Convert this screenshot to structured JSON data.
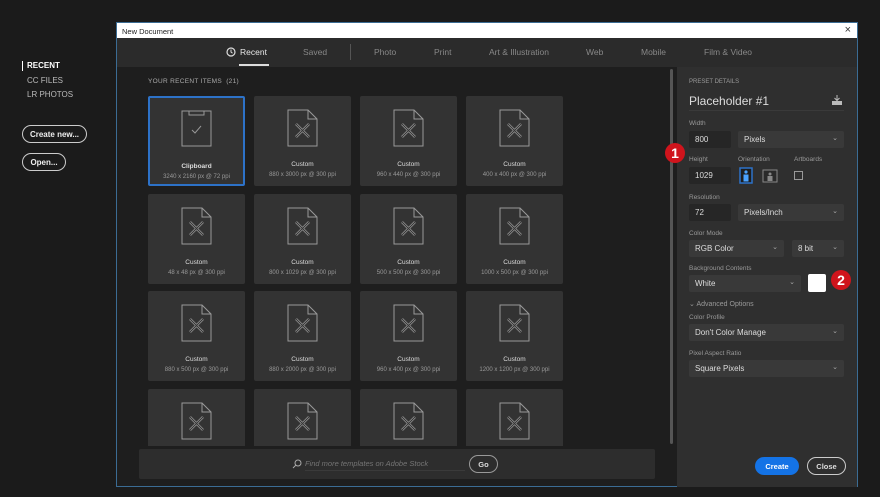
{
  "sidebar": {
    "items": [
      {
        "label": "RECENT",
        "active": true
      },
      {
        "label": "CC FILES"
      },
      {
        "label": "LR PHOTOS"
      }
    ],
    "create_new": "Create new...",
    "open": "Open..."
  },
  "window": {
    "title": "New Document",
    "close": "×"
  },
  "tabs": [
    "Recent",
    "Saved",
    "Photo",
    "Print",
    "Art & Illustration",
    "Web",
    "Mobile",
    "Film & Video"
  ],
  "recent": {
    "title": "YOUR RECENT ITEMS",
    "count": "(21)",
    "items": [
      {
        "name": "Clipboard",
        "dim": "3240 x 2160 px @ 72 ppi"
      },
      {
        "name": "Custom",
        "dim": "880 x 3000 px @ 300 ppi"
      },
      {
        "name": "Custom",
        "dim": "960 x 440 px @ 300 ppi"
      },
      {
        "name": "Custom",
        "dim": "400 x 400 px @ 300 ppi"
      },
      {
        "name": "Custom",
        "dim": "48 x 48 px @ 300 ppi"
      },
      {
        "name": "Custom",
        "dim": "800 x 1029 px @ 300 ppi"
      },
      {
        "name": "Custom",
        "dim": "500 x 500 px @ 300 ppi"
      },
      {
        "name": "Custom",
        "dim": "1000 x 500 px @ 300 ppi"
      },
      {
        "name": "Custom",
        "dim": "880 x 500 px @ 300 ppi"
      },
      {
        "name": "Custom",
        "dim": "880 x 2000 px @ 300 ppi"
      },
      {
        "name": "Custom",
        "dim": "960 x 400 px @ 300 ppi"
      },
      {
        "name": "Custom",
        "dim": "1200 x 1200 px @ 300 ppi"
      },
      {
        "name": "",
        "dim": ""
      },
      {
        "name": "",
        "dim": ""
      },
      {
        "name": "",
        "dim": ""
      },
      {
        "name": "",
        "dim": ""
      }
    ]
  },
  "search": {
    "placeholder": "Find more templates on Adobe Stock",
    "go": "Go"
  },
  "preset": {
    "section": "PRESET DETAILS",
    "name": "Placeholder #1",
    "width_label": "Width",
    "width": "800",
    "width_unit": "Pixels",
    "height_label": "Height",
    "height": "1029",
    "orientation_label": "Orientation",
    "artboards_label": "Artboards",
    "resolution_label": "Resolution",
    "resolution": "72",
    "resolution_unit": "Pixels/Inch",
    "color_mode_label": "Color Mode",
    "color_mode": "RGB Color",
    "bit_depth": "8 bit",
    "bg_label": "Background Contents",
    "bg": "White",
    "advanced": "Advanced Options",
    "profile_label": "Color Profile",
    "profile": "Don't Color Manage",
    "aspect_label": "Pixel Aspect Ratio",
    "aspect": "Square Pixels"
  },
  "badges": [
    "1",
    "2"
  ],
  "buttons": {
    "create": "Create",
    "close": "Close"
  },
  "colors": {
    "accent": "#2d72c8",
    "badge": "#d0141c"
  }
}
